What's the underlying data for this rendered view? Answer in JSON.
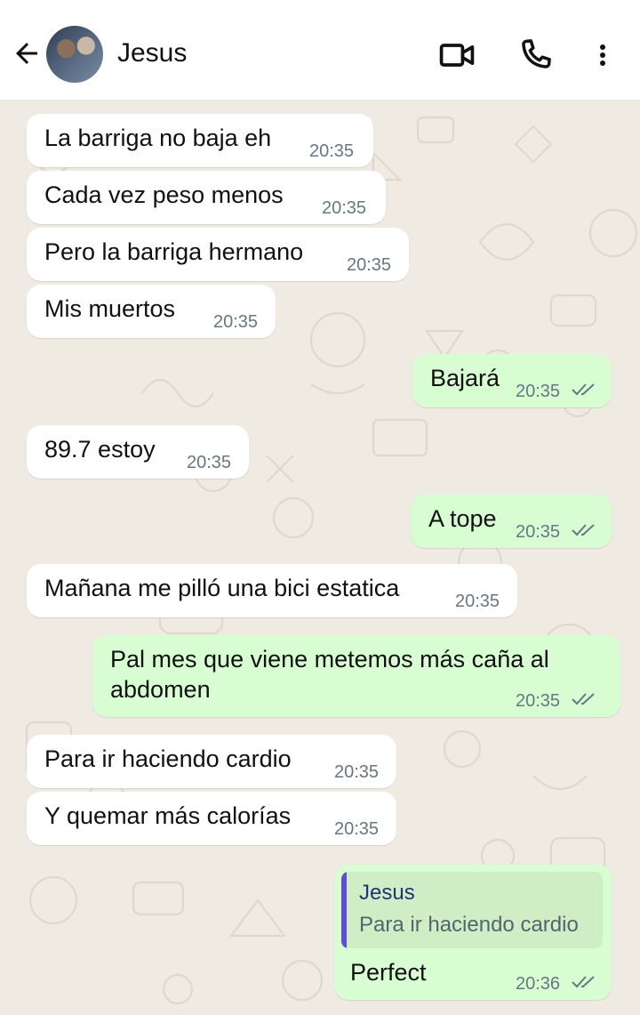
{
  "header": {
    "contact_name": "Jesus",
    "back_icon": "arrow-left-icon",
    "video_icon": "video-call-icon",
    "call_icon": "phone-icon",
    "menu_icon": "more-vert-icon"
  },
  "messages": [
    {
      "direction": "in",
      "text": "La barriga no baja eh",
      "time": "20:35"
    },
    {
      "direction": "in",
      "text": "Cada vez peso menos",
      "time": "20:35"
    },
    {
      "direction": "in",
      "text": "Pero la barriga hermano",
      "time": "20:35"
    },
    {
      "direction": "in",
      "text": "Mis muertos",
      "time": "20:35"
    },
    {
      "direction": "out",
      "text": "Bajará",
      "time": "20:35",
      "status": "read"
    },
    {
      "direction": "in",
      "text": "89.7 estoy",
      "time": "20:35"
    },
    {
      "direction": "out",
      "text": "A tope",
      "time": "20:35",
      "status": "read"
    },
    {
      "direction": "in",
      "text": "Mañana me pilló una bici estatica",
      "time": "20:35"
    },
    {
      "direction": "out",
      "text": "Pal mes que viene metemos más caña al abdomen",
      "time": "20:35",
      "status": "read"
    },
    {
      "direction": "in",
      "text": "Para ir haciendo cardio",
      "time": "20:35"
    },
    {
      "direction": "in",
      "text": "Y quemar más calorías",
      "time": "20:35"
    },
    {
      "direction": "out",
      "text": "Perfect",
      "time": "20:36",
      "status": "read",
      "reply_to": {
        "author": "Jesus",
        "text": "Para ir haciendo cardio"
      }
    }
  ],
  "colors": {
    "incoming_bubble": "#ffffff",
    "outgoing_bubble": "#d9fdd3",
    "read_ticks": "#667781",
    "quote_bar": "#5e4fd1",
    "wallpaper": "#efeae2"
  }
}
